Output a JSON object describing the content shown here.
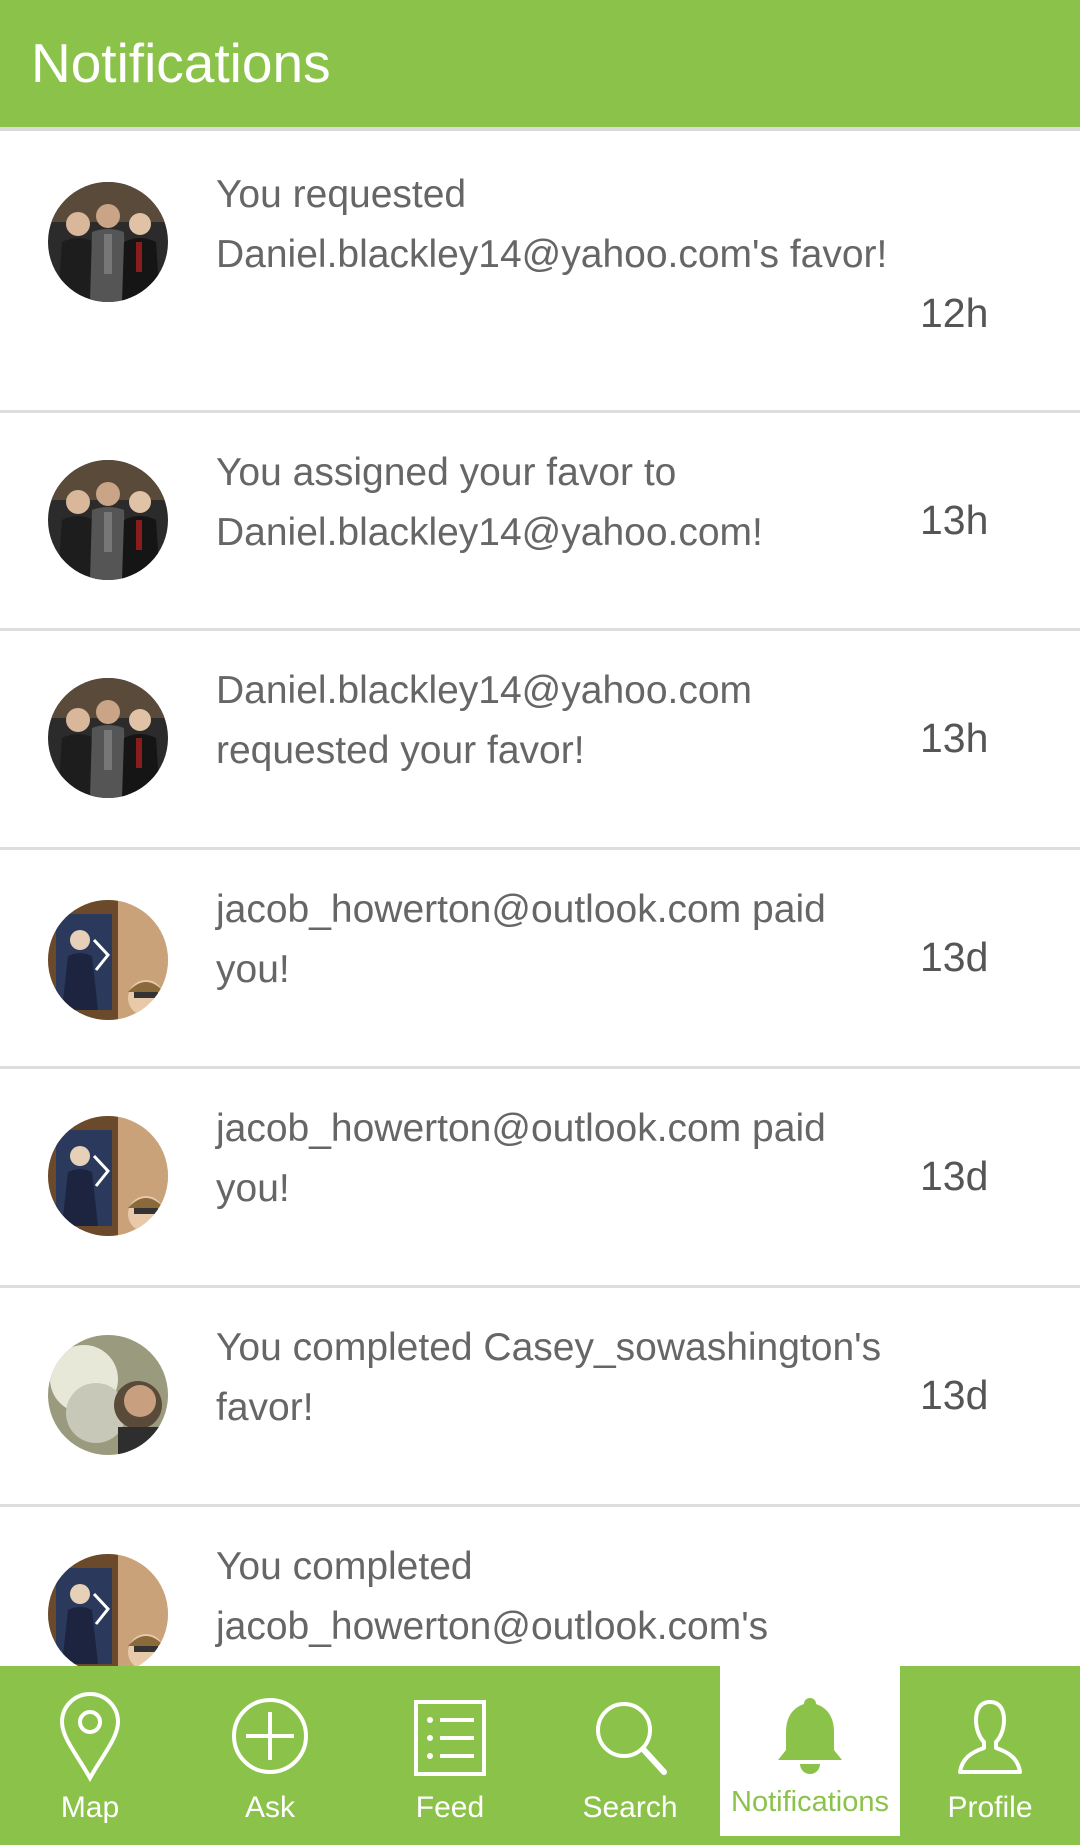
{
  "header": {
    "title": "Notifications"
  },
  "notifications": [
    {
      "message": "You requested Daniel.blackley14@yahoo.com's favor!",
      "time": "12h",
      "avatar": "group-photo"
    },
    {
      "message": "You assigned your favor to Daniel.blackley14@yahoo.com!",
      "time": "13h",
      "avatar": "group-photo"
    },
    {
      "message": "Daniel.blackley14@yahoo.com requested your favor!",
      "time": "13h",
      "avatar": "group-photo"
    },
    {
      "message": "jacob_howerton@outlook.com paid you!",
      "time": "13d",
      "avatar": "poster-selfie-photo"
    },
    {
      "message": "jacob_howerton@outlook.com paid you!",
      "time": "13d",
      "avatar": "poster-selfie-photo"
    },
    {
      "message": "You completed Casey_sowashington's favor!",
      "time": "13d",
      "avatar": "smoke-photo"
    },
    {
      "message": "You completed jacob_howerton@outlook.com's",
      "time": "",
      "avatar": "poster-selfie-photo"
    }
  ],
  "nav": {
    "active": "Notifications",
    "items": [
      {
        "label": "Map",
        "icon": "map-pin-icon"
      },
      {
        "label": "Ask",
        "icon": "plus-circle-icon"
      },
      {
        "label": "Feed",
        "icon": "list-icon"
      },
      {
        "label": "Search",
        "icon": "search-icon"
      },
      {
        "label": "Notifications",
        "icon": "bell-icon"
      },
      {
        "label": "Profile",
        "icon": "person-icon"
      }
    ]
  },
  "colors": {
    "brand": "#8bc34a",
    "text": "#666666",
    "divider": "#dddddd"
  }
}
